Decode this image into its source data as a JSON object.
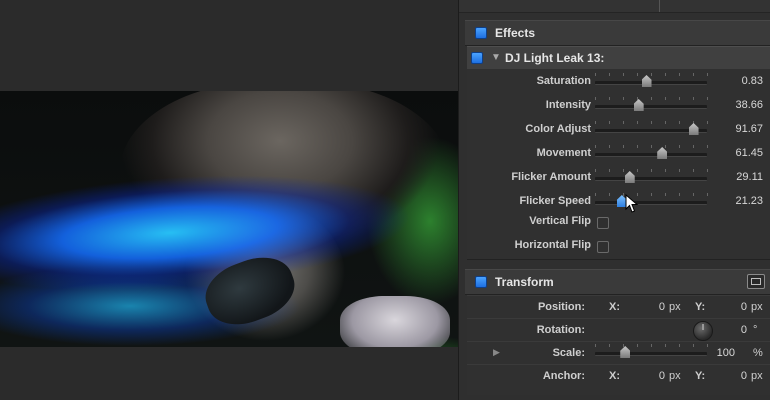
{
  "inspector": {
    "effects_title": "Effects",
    "effect_name": "DJ Light Leak 13:",
    "params": [
      {
        "label": "Saturation",
        "value": "0.83",
        "position": 0.46
      },
      {
        "label": "Intensity",
        "value": "38.66",
        "position": 0.39
      },
      {
        "label": "Color Adjust",
        "value": "91.67",
        "position": 0.88
      },
      {
        "label": "Movement",
        "value": "61.45",
        "position": 0.6
      },
      {
        "label": "Flicker Amount",
        "value": "29.11",
        "position": 0.31
      },
      {
        "label": "Flicker Speed",
        "value": "21.23",
        "position": 0.24
      }
    ],
    "checkbox_params": [
      {
        "label": "Vertical Flip",
        "checked": false
      },
      {
        "label": "Horizontal Flip",
        "checked": false
      }
    ],
    "transform": {
      "title": "Transform",
      "position_label": "Position:",
      "x_label": "X:",
      "y_label": "Y:",
      "position_x": "0",
      "position_y": "0",
      "px": "px",
      "rotation_label": "Rotation:",
      "rotation_value": "0",
      "rotation_unit": "°",
      "scale_label": "Scale:",
      "scale_value": "100",
      "scale_unit": "%",
      "scale_position": 0.27,
      "anchor_label": "Anchor:",
      "anchor_x": "0",
      "anchor_y": "0"
    }
  },
  "colors": {
    "accent": "#2e7fe0",
    "panel": "#2f2f2f",
    "header": "#3a3a3a"
  }
}
